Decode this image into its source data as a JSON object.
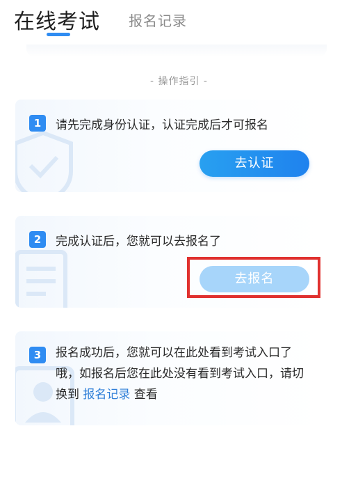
{
  "header": {
    "tab_active": "在线考试",
    "tab_inactive": "报名记录"
  },
  "guide_title": "- 操作指引 -",
  "steps": [
    {
      "number": "1",
      "text": "请先完成身份认证，认证完成后才可报名",
      "button_label": "去认证"
    },
    {
      "number": "2",
      "text": "完成认证后，您就可以去报名了",
      "button_label": "去报名"
    },
    {
      "number": "3",
      "text_before": "报名成功后，您就可以在此处看到考试入口了哦，如报名后您在此处没有看到考试入口，请切换到 ",
      "link_label": "报名记录",
      "text_after": " 查看"
    }
  ],
  "colors": {
    "accent": "#2f8cf2",
    "button_disabled": "#a7d5fa",
    "highlight": "#e0312f",
    "link": "#2f7fd8"
  }
}
